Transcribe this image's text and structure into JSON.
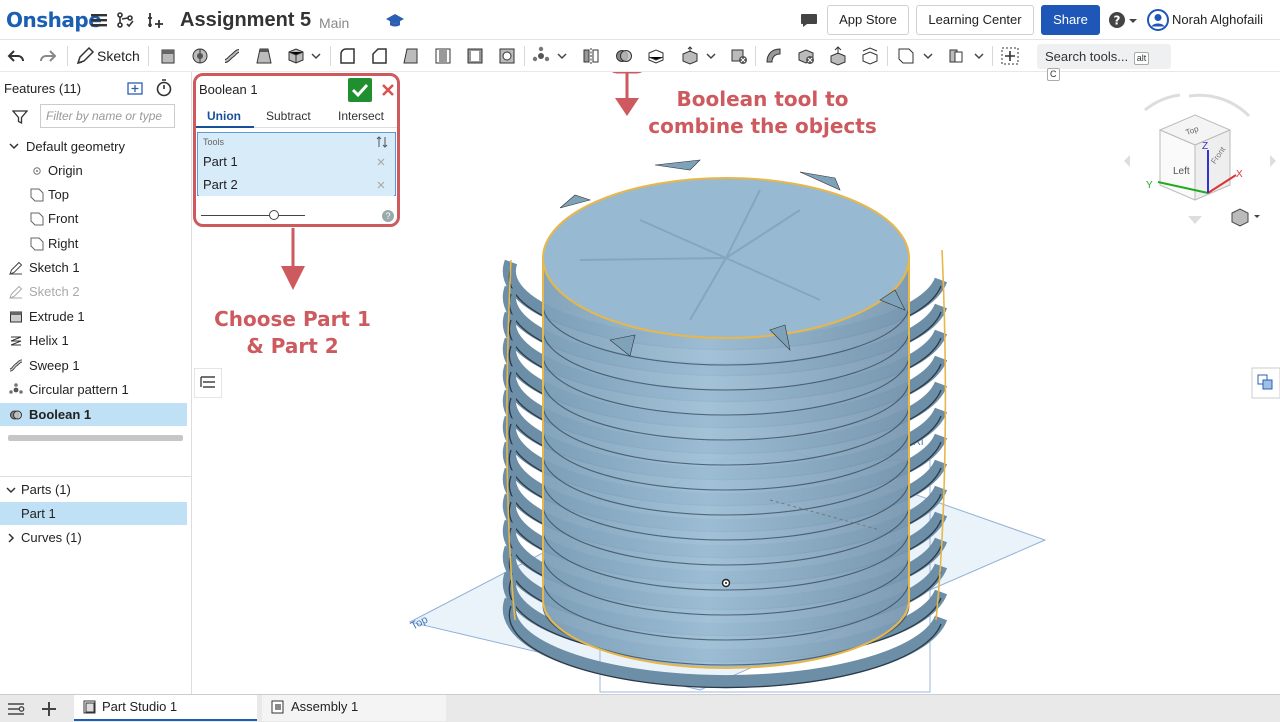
{
  "app": {
    "logo": "Onshape",
    "document_title": "Assignment 5",
    "branch": "Main"
  },
  "header": {
    "app_store": "App Store",
    "learning_center": "Learning Center",
    "share": "Share",
    "user_name": "Norah Alghofaili"
  },
  "toolbar": {
    "sketch_label": "Sketch",
    "search_label": "Search tools...",
    "search_shortcut_1": "alt",
    "search_shortcut_2": "C"
  },
  "features": {
    "header": "Features (11)",
    "filter_placeholder": "Filter by name or type",
    "items": [
      {
        "label": "Default geometry"
      },
      {
        "label": "Origin"
      },
      {
        "label": "Top"
      },
      {
        "label": "Front"
      },
      {
        "label": "Right"
      },
      {
        "label": "Sketch 1"
      },
      {
        "label": "Sketch 2"
      },
      {
        "label": "Extrude 1"
      },
      {
        "label": "Helix 1"
      },
      {
        "label": "Sweep 1"
      },
      {
        "label": "Circular pattern 1"
      },
      {
        "label": "Boolean 1"
      }
    ]
  },
  "parts": {
    "header": "Parts (1)",
    "item": "Part 1",
    "curves": "Curves (1)"
  },
  "dialog": {
    "title": "Boolean 1",
    "tabs": [
      "Union",
      "Subtract",
      "Intersect"
    ],
    "tools_label": "Tools",
    "tool_items": [
      "Part 1",
      "Part 2"
    ],
    "help": "?",
    "slider_fraction": 0.7
  },
  "annotations": {
    "boolean_tool_line1": "Boolean tool to",
    "boolean_tool_line2": "combine the objects",
    "choose_line1": "Choose Part 1",
    "choose_line2": "& Part 2",
    "color": "#cd5a5e"
  },
  "viewport": {
    "plane_label_top": "Top",
    "plane_label_right": "Ri",
    "plane_label_front": "Fr",
    "cube_left": "Left",
    "cube_top": "Top",
    "cube_front": "Front",
    "axis_x": "X",
    "axis_y": "Y",
    "axis_z": "Z"
  },
  "bottom_tabs": {
    "part_studio": "Part Studio 1",
    "assembly": "Assembly 1"
  },
  "colors": {
    "brand": "#1a5fb4",
    "share": "#1f57b8",
    "selection": "#bfe0f5",
    "part_fill": "#8fb3cc",
    "part_outline": "#e8b74a",
    "ok_green": "#1f8f2f"
  }
}
